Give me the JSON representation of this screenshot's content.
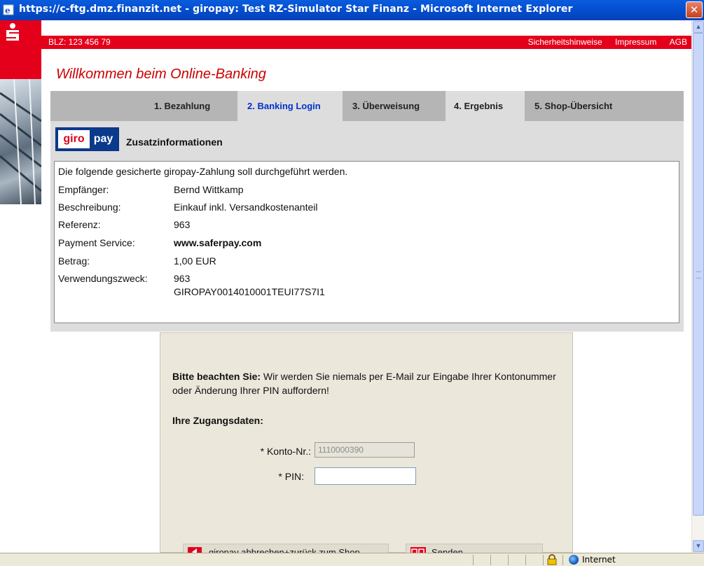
{
  "window": {
    "title": "https://c-ftg.dmz.finanzit.net - giropay: Test RZ-Simulator Star Finanz - Microsoft Internet Explorer",
    "close_glyph": "✕"
  },
  "header": {
    "blz": "BLZ: 123 456 79",
    "links": [
      "Sicherheitshinweise",
      "Impressum",
      "AGB"
    ]
  },
  "page": {
    "welcome": "Willkommen beim Online-Banking"
  },
  "tabs": [
    {
      "label": "1. Bezahlung",
      "active": false
    },
    {
      "label": "2. Banking Login",
      "active": true
    },
    {
      "label": "3. Überweisung",
      "active": false
    },
    {
      "label": "4. Ergebnis",
      "active": false
    },
    {
      "label": "5. Shop-Übersicht",
      "active": false
    }
  ],
  "info": {
    "logo_giro": "giro",
    "logo_pay": "pay",
    "heading": "Zusatzinformationen",
    "intro": "Die folgende gesicherte giropay-Zahlung soll durchgeführt werden.",
    "rows": [
      {
        "label": "Empfänger:",
        "value": "Bernd Wittkamp"
      },
      {
        "label": "Beschreibung:",
        "value": "Einkauf inkl. Versandkostenanteil"
      },
      {
        "label": "Referenz:",
        "value": "963"
      },
      {
        "label": "Payment Service:",
        "value": "www.saferpay.com"
      },
      {
        "label": "Betrag:",
        "value": "1,00 EUR"
      },
      {
        "label": "Verwendungszweck:",
        "value": "963",
        "value2": "GIROPAY0014010001TEUI77S7I1"
      }
    ]
  },
  "login": {
    "notice_bold": "Bitte beachten Sie:",
    "notice_text": " Wir werden Sie niemals per E-Mail zur Eingabe Ihrer Kontonummer oder Änderung Ihrer PIN auffordern!",
    "credentials_heading": "Ihre Zugangsdaten:",
    "konto_label": "* Konto-Nr.:",
    "konto_value": "1110000390",
    "pin_label": "* PIN:",
    "pin_value": "",
    "cancel_button": "giropay abbrechen+zurück zum Shop",
    "send_button": "Senden"
  },
  "statusbar": {
    "zone": "Internet"
  },
  "colors": {
    "brand_red": "#E4001B",
    "active_tab_text": "#0033CC",
    "welcome_text": "#CC0000"
  }
}
